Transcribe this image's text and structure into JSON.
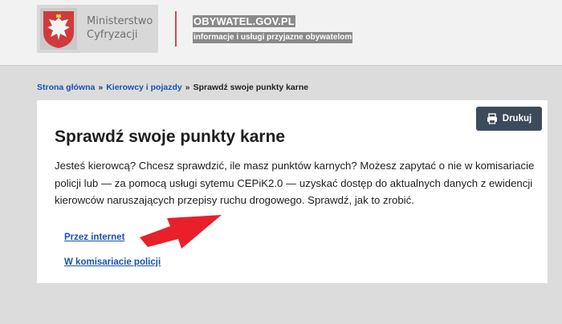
{
  "header": {
    "ministry_line1": "Ministerstwo",
    "ministry_line2": "Cyfryzacji",
    "portal_name": "OBYWATEL.GOV.PL",
    "portal_tagline": "informacje i usługi przyjazne obywatelom",
    "emblem_icon": "polish-eagle-icon"
  },
  "breadcrumb": {
    "home": "Strona główna",
    "category": "Kierowcy i pojazdy",
    "current": "Sprawdź swoje punkty karne",
    "separator": "»"
  },
  "main": {
    "print_label": "Drukuj",
    "print_icon": "printer-icon",
    "title": "Sprawdź swoje punkty karne",
    "intro": "Jesteś kierowcą? Chcesz sprawdzić, ile masz punktów karnych? Możesz zapytać o nie w komisariacie policji lub — za pomocą usługi sytemu CEPiK2.0 — uzyskać dostęp do aktualnych danych z ewidencji kierowców naruszających przepisy ruchu drogowego. Sprawdź, jak to zrobić.",
    "options": [
      {
        "label": "Przez internet"
      },
      {
        "label": "W komisariacie policji"
      }
    ]
  },
  "colors": {
    "link": "#1a52b0",
    "accent_red": "#d04a4a",
    "annotation_arrow": "#e8202a",
    "print_button": "#3c4b5c"
  }
}
